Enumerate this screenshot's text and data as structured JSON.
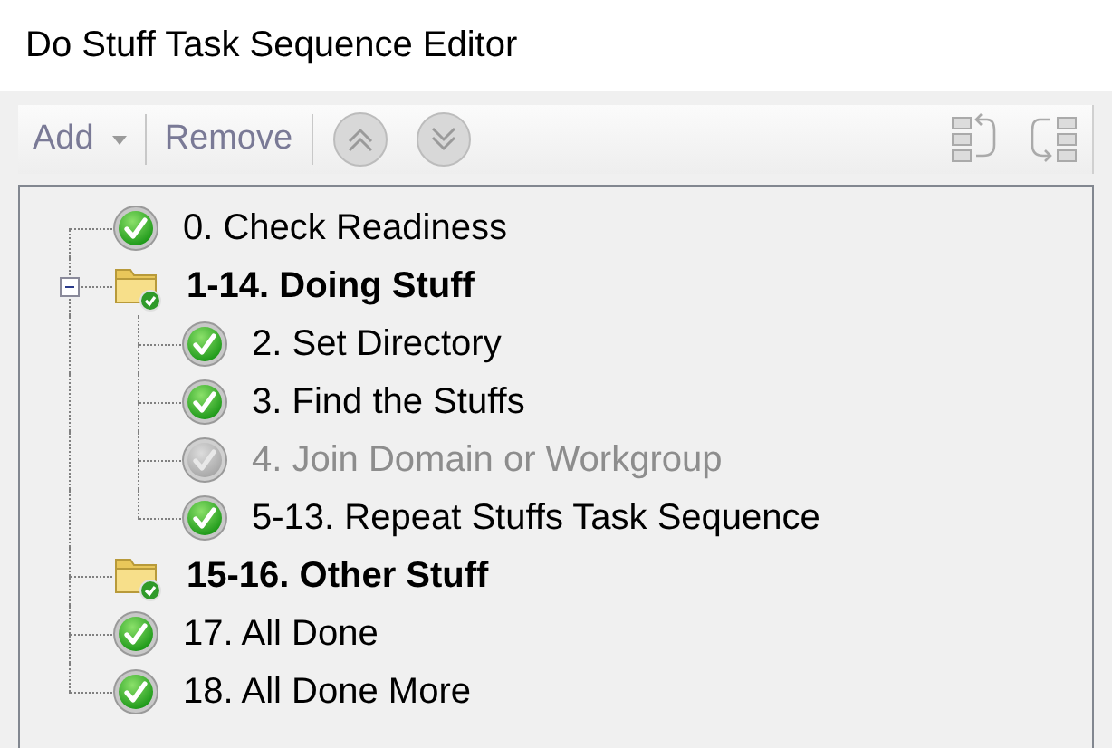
{
  "window": {
    "title": "Do Stuff Task Sequence Editor"
  },
  "toolbar": {
    "add": {
      "label": "Add",
      "disabled": true
    },
    "remove": {
      "label": "Remove",
      "disabled": true
    }
  },
  "tree": [
    {
      "kind": "task",
      "label": "0. Check Readiness",
      "disabled": false
    },
    {
      "kind": "group",
      "label": "1-14. Doing Stuff",
      "expanded": true,
      "children": [
        {
          "kind": "task",
          "label": "2. Set Directory",
          "disabled": false
        },
        {
          "kind": "task",
          "label": "3. Find the Stuffs",
          "disabled": false
        },
        {
          "kind": "task",
          "label": "4. Join Domain or Workgroup",
          "disabled": true
        },
        {
          "kind": "task",
          "label": "5-13. Repeat Stuffs Task Sequence",
          "disabled": false
        }
      ]
    },
    {
      "kind": "group",
      "label": "15-16. Other Stuff"
    },
    {
      "kind": "task",
      "label": "17. All Done",
      "disabled": false
    },
    {
      "kind": "task",
      "label": "18. All Done More",
      "disabled": false
    }
  ]
}
